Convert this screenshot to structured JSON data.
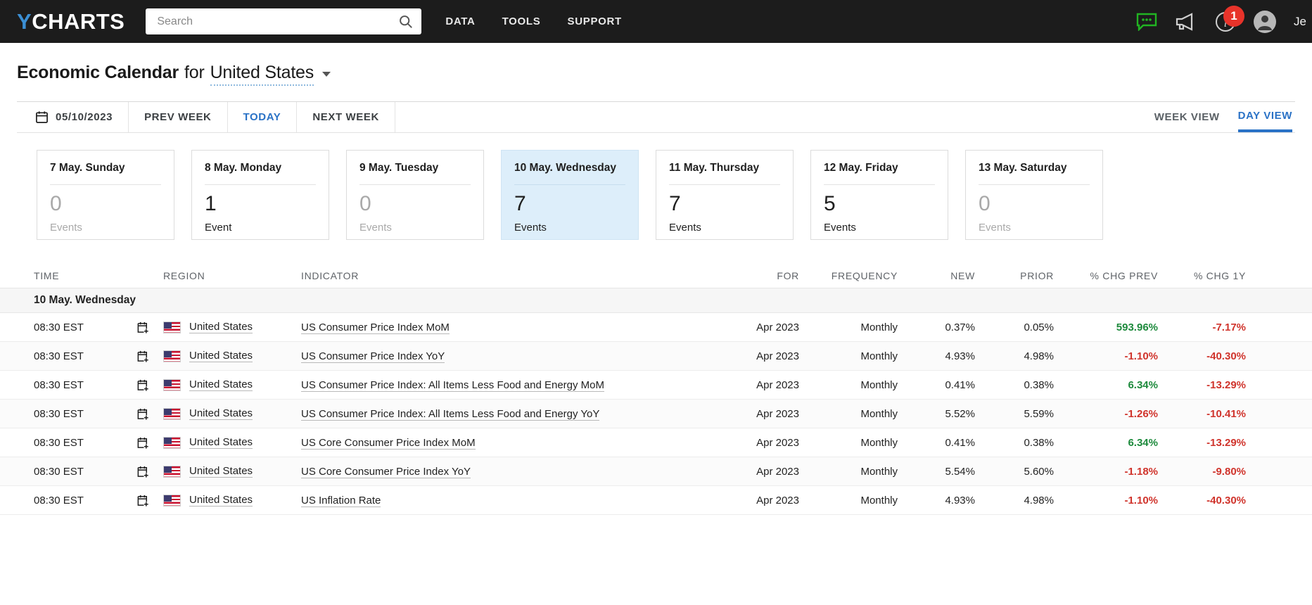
{
  "header": {
    "logo_y": "Y",
    "logo_rest": "CHARTS",
    "search_placeholder": "Search",
    "nav": [
      {
        "label": "DATA",
        "name": "nav-data"
      },
      {
        "label": "TOOLS",
        "name": "nav-tools"
      },
      {
        "label": "SUPPORT",
        "name": "nav-support"
      }
    ],
    "chat_icon": "chat-icon",
    "megaphone_icon": "megaphone-icon",
    "info_icon": "info-icon",
    "notification_count": "1",
    "avatar_icon": "avatar-icon",
    "username": "Je",
    "accent_color": "#3b8fd4",
    "badge_color": "#e8332a"
  },
  "page": {
    "title_strong": "Economic Calendar",
    "title_for": "for",
    "region": "United States"
  },
  "toolbar": {
    "date": "05/10/2023",
    "calendar_icon": "calendar-icon",
    "prev_week": "PREV WEEK",
    "today": "TODAY",
    "next_week": "NEXT WEEK",
    "week_view": "WEEK VIEW",
    "day_view": "DAY VIEW"
  },
  "day_cards": [
    {
      "title": "7 May. Sunday",
      "count": "0",
      "label": "Events",
      "active": false,
      "empty": true
    },
    {
      "title": "8 May. Monday",
      "count": "1",
      "label": "Event",
      "active": false,
      "empty": false
    },
    {
      "title": "9 May. Tuesday",
      "count": "0",
      "label": "Events",
      "active": false,
      "empty": true
    },
    {
      "title": "10 May. Wednesday",
      "count": "7",
      "label": "Events",
      "active": true,
      "empty": false
    },
    {
      "title": "11 May. Thursday",
      "count": "7",
      "label": "Events",
      "active": false,
      "empty": false
    },
    {
      "title": "12 May. Friday",
      "count": "5",
      "label": "Events",
      "active": false,
      "empty": false
    },
    {
      "title": "13 May. Saturday",
      "count": "0",
      "label": "Events",
      "active": false,
      "empty": true
    }
  ],
  "table": {
    "columns": {
      "time": "TIME",
      "region": "REGION",
      "indicator": "INDICATOR",
      "for": "FOR",
      "frequency": "FREQUENCY",
      "new": "NEW",
      "prior": "PRIOR",
      "chg_prev": "% CHG PREV",
      "chg_1y": "% CHG 1Y"
    },
    "group_label": "10 May. Wednesday",
    "rows": [
      {
        "time": "08:30 EST",
        "region": "United States",
        "indicator": "US Consumer Price Index MoM",
        "for": "Apr 2023",
        "frequency": "Monthly",
        "new": "0.37%",
        "prior": "0.05%",
        "chg_prev": "593.96%",
        "chg_prev_dir": "pos",
        "chg_1y": "-7.17%",
        "chg_1y_dir": "neg"
      },
      {
        "time": "08:30 EST",
        "region": "United States",
        "indicator": "US Consumer Price Index YoY",
        "for": "Apr 2023",
        "frequency": "Monthly",
        "new": "4.93%",
        "prior": "4.98%",
        "chg_prev": "-1.10%",
        "chg_prev_dir": "neg",
        "chg_1y": "-40.30%",
        "chg_1y_dir": "neg"
      },
      {
        "time": "08:30 EST",
        "region": "United States",
        "indicator": "US Consumer Price Index: All Items Less Food and Energy MoM",
        "for": "Apr 2023",
        "frequency": "Monthly",
        "new": "0.41%",
        "prior": "0.38%",
        "chg_prev": "6.34%",
        "chg_prev_dir": "pos",
        "chg_1y": "-13.29%",
        "chg_1y_dir": "neg"
      },
      {
        "time": "08:30 EST",
        "region": "United States",
        "indicator": "US Consumer Price Index: All Items Less Food and Energy YoY",
        "for": "Apr 2023",
        "frequency": "Monthly",
        "new": "5.52%",
        "prior": "5.59%",
        "chg_prev": "-1.26%",
        "chg_prev_dir": "neg",
        "chg_1y": "-10.41%",
        "chg_1y_dir": "neg"
      },
      {
        "time": "08:30 EST",
        "region": "United States",
        "indicator": "US Core Consumer Price Index MoM",
        "for": "Apr 2023",
        "frequency": "Monthly",
        "new": "0.41%",
        "prior": "0.38%",
        "chg_prev": "6.34%",
        "chg_prev_dir": "pos",
        "chg_1y": "-13.29%",
        "chg_1y_dir": "neg"
      },
      {
        "time": "08:30 EST",
        "region": "United States",
        "indicator": "US Core Consumer Price Index YoY",
        "for": "Apr 2023",
        "frequency": "Monthly",
        "new": "5.54%",
        "prior": "5.60%",
        "chg_prev": "-1.18%",
        "chg_prev_dir": "neg",
        "chg_1y": "-9.80%",
        "chg_1y_dir": "neg"
      },
      {
        "time": "08:30 EST",
        "region": "United States",
        "indicator": "US Inflation Rate",
        "for": "Apr 2023",
        "frequency": "Monthly",
        "new": "4.93%",
        "prior": "4.98%",
        "chg_prev": "-1.10%",
        "chg_prev_dir": "neg",
        "chg_1y": "-40.30%",
        "chg_1y_dir": "neg"
      }
    ]
  }
}
